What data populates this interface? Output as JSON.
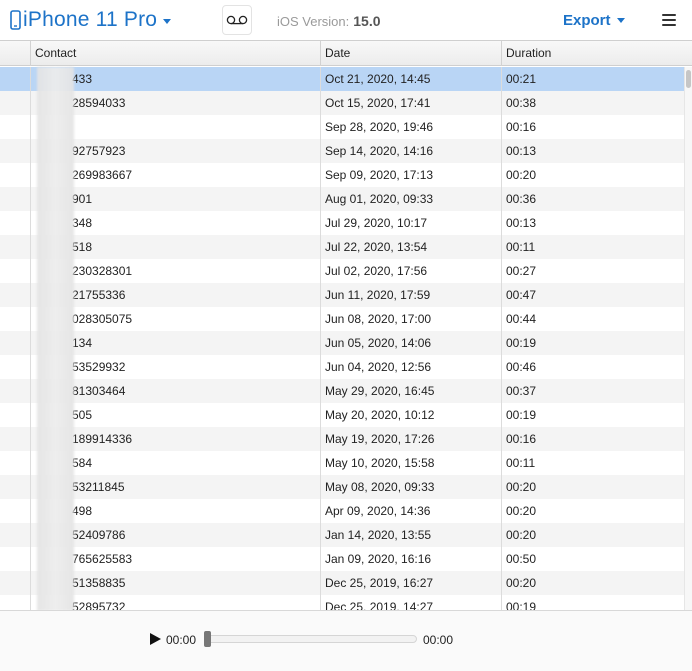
{
  "header": {
    "device_name": "iPhone 11 Pro",
    "ios_label": "iOS Version:",
    "ios_version": "15.0",
    "export_label": "Export"
  },
  "table": {
    "columns": [
      "Contact",
      "Date",
      "Duration"
    ],
    "rows": [
      {
        "contact": "433",
        "date": "Oct 21, 2020, 14:45",
        "duration": "00:21"
      },
      {
        "contact": "28594033",
        "date": "Oct 15, 2020, 17:41",
        "duration": "00:38"
      },
      {
        "contact": "",
        "date": "Sep 28, 2020, 19:46",
        "duration": "00:16"
      },
      {
        "contact": "92757923",
        "date": "Sep 14, 2020, 14:16",
        "duration": "00:13"
      },
      {
        "contact": "269983667",
        "date": "Sep 09, 2020, 17:13",
        "duration": "00:20"
      },
      {
        "contact": "901",
        "date": "Aug 01, 2020, 09:33",
        "duration": "00:36"
      },
      {
        "contact": "348",
        "date": "Jul 29, 2020, 10:17",
        "duration": "00:13"
      },
      {
        "contact": "518",
        "date": "Jul 22, 2020, 13:54",
        "duration": "00:11"
      },
      {
        "contact": "230328301",
        "date": "Jul 02, 2020, 17:56",
        "duration": "00:27"
      },
      {
        "contact": "21755336",
        "date": "Jun 11, 2020, 17:59",
        "duration": "00:47"
      },
      {
        "contact": "028305075",
        "date": "Jun 08, 2020, 17:00",
        "duration": "00:44"
      },
      {
        "contact": "134",
        "date": "Jun 05, 2020, 14:06",
        "duration": "00:19"
      },
      {
        "contact": "53529932",
        "date": "Jun 04, 2020, 12:56",
        "duration": "00:46"
      },
      {
        "contact": "81303464",
        "date": "May 29, 2020, 16:45",
        "duration": "00:37"
      },
      {
        "contact": "505",
        "date": "May 20, 2020, 10:12",
        "duration": "00:19"
      },
      {
        "contact": "189914336",
        "date": "May 19, 2020, 17:26",
        "duration": "00:16"
      },
      {
        "contact": "584",
        "date": "May 10, 2020, 15:58",
        "duration": "00:11"
      },
      {
        "contact": "53211845",
        "date": "May 08, 2020, 09:33",
        "duration": "00:20"
      },
      {
        "contact": "498",
        "date": "Apr 09, 2020, 14:36",
        "duration": "00:20"
      },
      {
        "contact": "52409786",
        "date": "Jan 14, 2020, 13:55",
        "duration": "00:20"
      },
      {
        "contact": "765625583",
        "date": "Jan 09, 2020, 16:16",
        "duration": "00:50"
      },
      {
        "contact": "51358835",
        "date": "Dec 25, 2019, 16:27",
        "duration": "00:20"
      },
      {
        "contact": "52895732",
        "date": "Dec 25, 2019, 14:27",
        "duration": "00:19"
      }
    ],
    "selected_row": 0
  },
  "player": {
    "current_time": "00:00",
    "total_time": "00:00",
    "progress": 0
  },
  "icons": {
    "device": "phone-icon",
    "voicemail": "voicemail-icon",
    "menu": "hamburger-menu-icon",
    "play": "play-icon"
  },
  "colors": {
    "accent": "#1d73c8",
    "selected_row": "#b9d5f5"
  }
}
